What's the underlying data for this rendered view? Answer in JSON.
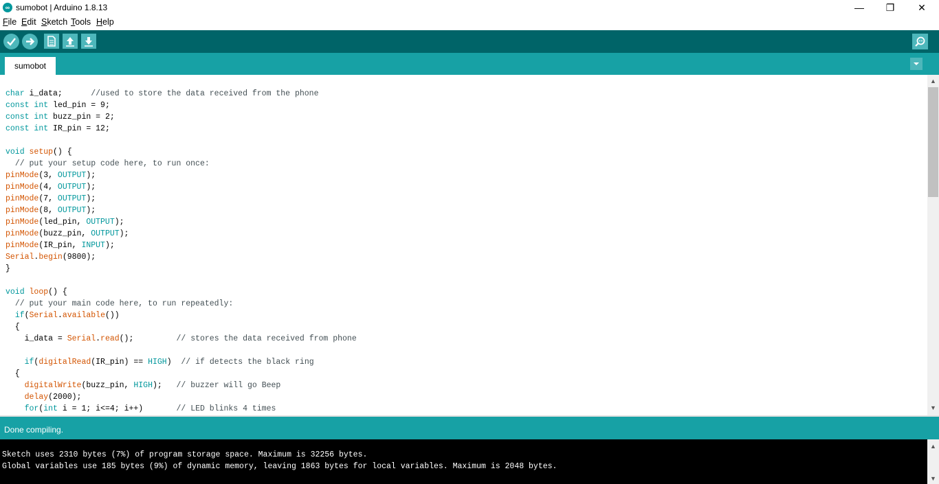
{
  "window": {
    "title": "sumobot | Arduino 1.8.13",
    "app_icon_text": "∞",
    "controls": {
      "minimize": "—",
      "maximize": "❐",
      "close": "✕"
    }
  },
  "menu": [
    "File",
    "Edit",
    "Sketch",
    "Tools",
    "Help"
  ],
  "toolbar": {
    "buttons": [
      "verify-icon",
      "upload-icon",
      "new-sketch-icon",
      "open-icon",
      "save-icon"
    ],
    "right": "serial-monitor-icon"
  },
  "tabs": {
    "items": [
      {
        "label": "sumobot",
        "active": true
      }
    ],
    "menu_icon": "chevron-down-icon"
  },
  "editor": {
    "lines": [
      "char i_data;      //used to store the data received from the phone",
      "const int led_pin = 9;",
      "const int buzz_pin = 2;",
      "const int IR_pin = 12;",
      "",
      "void setup() {",
      "  // put your setup code here, to run once:",
      "pinMode(3, OUTPUT);",
      "pinMode(4, OUTPUT);",
      "pinMode(7, OUTPUT);",
      "pinMode(8, OUTPUT);",
      "pinMode(led_pin, OUTPUT);",
      "pinMode(buzz_pin, OUTPUT);",
      "pinMode(IR_pin, INPUT);",
      "Serial.begin(9800);",
      "}",
      "",
      "void loop() {",
      "  // put your main code here, to run repeatedly:",
      "  if(Serial.available())",
      "  {",
      "    i_data = Serial.read();         // stores the data received from phone",
      "",
      "    if(digitalRead(IR_pin) == HIGH)  // if detects the black ring",
      "  {",
      "    digitalWrite(buzz_pin, HIGH);   // buzzer will go Beep",
      "    delay(2000);",
      "    for(int i = 1; i<=4; i++)       // LED blinks 4 times"
    ]
  },
  "status": {
    "text": "Done compiling."
  },
  "console": {
    "lines": [
      "Sketch uses 2310 bytes (7%) of program storage space. Maximum is 32256 bytes.",
      "Global variables use 185 bytes (9%) of dynamic memory, leaving 1863 bytes for local variables. Maximum is 2048 bytes."
    ]
  },
  "colors": {
    "toolbar": "#006468",
    "tabbar": "#17a1a5",
    "button": "#4db7bb",
    "keyword": "#00979c",
    "function": "#d35400",
    "comment": "#434f54"
  }
}
